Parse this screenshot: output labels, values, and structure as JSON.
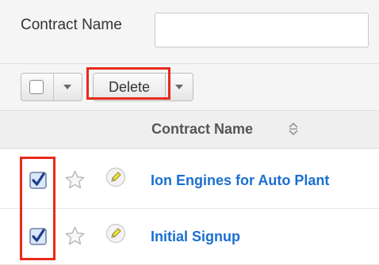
{
  "search": {
    "label": "Contract Name",
    "value": "",
    "placeholder": ""
  },
  "actions": {
    "delete_label": "Delete"
  },
  "table": {
    "column_header": "Contract Name",
    "rows": [
      {
        "name": "Ion Engines for Auto Plant",
        "checked": true,
        "favorite": false
      },
      {
        "name": "Initial Signup",
        "checked": true,
        "favorite": false
      }
    ]
  },
  "colors": {
    "link": "#1a6fd1",
    "highlight": "#e8291b",
    "checkbox_check": "#1c3f8a",
    "checkbox_fill": "#dbe8fb",
    "pencil": "#f2e533"
  },
  "icons": {
    "select_all": "checkbox-empty-icon",
    "dropdown": "chevron-down-icon",
    "sort": "sort-icon",
    "row_checkbox": "checkbox-checked-icon",
    "favorite": "star-outline-icon",
    "edit": "pencil-icon"
  }
}
